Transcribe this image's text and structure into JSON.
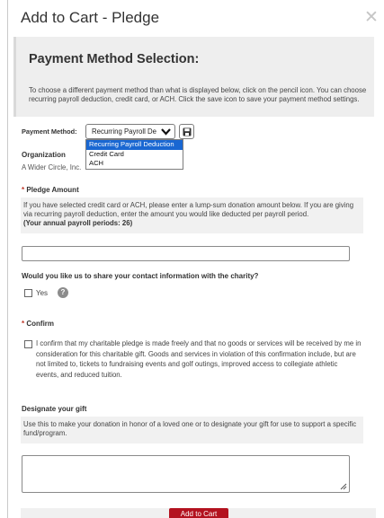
{
  "modal": {
    "title": "Add to Cart - Pledge",
    "close_symbol": "✕"
  },
  "payment_method": {
    "heading": "Payment Method Selection:",
    "description": "To choose a different payment method than what is displayed below, click on the pencil icon. You can choose recurring payroll deduction, credit card, or ACH. Click the save icon to save your payment method settings.",
    "label": "Payment Method:",
    "selected_value": "Recurring Payroll Deduction",
    "options": [
      "Recurring Payroll Deduction",
      "Credit Card",
      "ACH"
    ]
  },
  "organization": {
    "heading": "Organization",
    "value": "A Wider Circle, Inc."
  },
  "pledge_amount": {
    "required_mark": "*",
    "heading": "Pledge Amount",
    "help_text": "If you have selected credit card or ACH, please enter a lump-sum donation amount below. If you are giving via recurring payroll deduction, enter the amount you would like deducted per payroll period.",
    "payroll_note": "(Your annual payroll periods: 26)",
    "input_value": ""
  },
  "share_contact": {
    "heading": "Would you like us to share your contact information with the charity?",
    "yes_label": "Yes",
    "help_symbol": "?"
  },
  "confirm": {
    "required_mark": "*",
    "heading": "Confirm",
    "text": "I confirm that my charitable pledge is made freely and that no goods or services will be received by me in consideration for this charitable gift. Goods and services in violation of this confirmation include, but are not limited to, tickets to fundraising events and golf outings, improved access to collegiate athletic events, and reduced tuition."
  },
  "designate": {
    "heading": "Designate your gift",
    "help_text": "Use this to make your donation in honor of a loved one or to designate your gift for use to support a specific fund/program.",
    "textarea_value": ""
  },
  "footer": {
    "add_to_cart_label": "Add to Cart"
  },
  "colors": {
    "accent": "#b3121f",
    "selection": "#1967d2"
  }
}
